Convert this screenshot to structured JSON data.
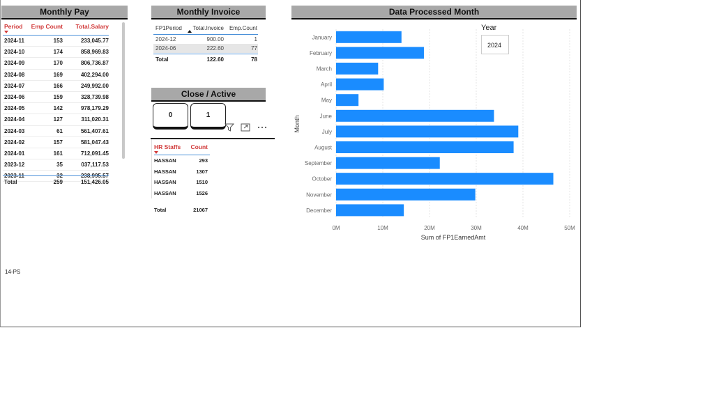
{
  "monthly_pay": {
    "title": "Monthly Pay",
    "headers": [
      "Period",
      "Emp Count",
      "Total.Salary"
    ],
    "rows": [
      [
        "2024-11",
        "153",
        "233,045.77"
      ],
      [
        "2024-10",
        "174",
        "858,969.83"
      ],
      [
        "2024-09",
        "170",
        "806,736.87"
      ],
      [
        "2024-08",
        "169",
        "402,294.00"
      ],
      [
        "2024-07",
        "166",
        "249,992.00"
      ],
      [
        "2024-06",
        "159",
        "328,739.98"
      ],
      [
        "2024-05",
        "142",
        "978,179.29"
      ],
      [
        "2024-04",
        "127",
        "311,020.31"
      ],
      [
        "2024-03",
        "61",
        "561,407.61"
      ],
      [
        "2024-02",
        "157",
        "581,047.43"
      ],
      [
        "2024-01",
        "161",
        "712,091.45"
      ],
      [
        "2023-12",
        "35",
        "037,117.53"
      ],
      [
        "2023-11",
        "32",
        "238,995.57"
      ]
    ],
    "total": [
      "Total",
      "259",
      "151,426.05"
    ]
  },
  "monthly_invoice": {
    "title": "Monthly Invoice",
    "headers": [
      "FP1Period",
      "Total.Invoice",
      "Emp.Count"
    ],
    "rows": [
      [
        "2024-12",
        "900.00",
        "1"
      ],
      [
        "2024-06",
        "222.60",
        "77"
      ]
    ],
    "total": [
      "Total",
      "122.60",
      "78"
    ]
  },
  "close_active": {
    "title": "Close / Active",
    "cards": [
      "0",
      "1"
    ]
  },
  "hr_staffs": {
    "headers": [
      "HR Staffs",
      "Count"
    ],
    "rows": [
      [
        "HASSAN",
        "293"
      ],
      [
        "HASSAN",
        "1307"
      ],
      [
        "HASSAN",
        "1510"
      ],
      [
        "HASSAN",
        "1526"
      ]
    ],
    "total": [
      "Total",
      "21067"
    ]
  },
  "data_processed": {
    "title": "Data Processed Month",
    "year_label": "Year",
    "year_value": "2024"
  },
  "footer_text": "14-PS",
  "colors": {
    "bar": "#1a8cff",
    "header_red": "#d13a3a",
    "panel_gray": "#a8a8a8"
  },
  "chart_data": {
    "type": "bar",
    "orientation": "horizontal",
    "categories": [
      "January",
      "February",
      "March",
      "April",
      "May",
      "June",
      "July",
      "August",
      "September",
      "October",
      "November",
      "December"
    ],
    "values": [
      14000000,
      18800000,
      9000000,
      10200000,
      4800000,
      33800000,
      39000000,
      38000000,
      22200000,
      46500000,
      29800000,
      14500000
    ],
    "xlabel": "Sum of FP1EarnedAmt",
    "ylabel": "Month",
    "xlim": [
      0,
      50000000
    ],
    "xticks": [
      "0M",
      "10M",
      "20M",
      "30M",
      "40M",
      "50M"
    ],
    "grid": true
  }
}
